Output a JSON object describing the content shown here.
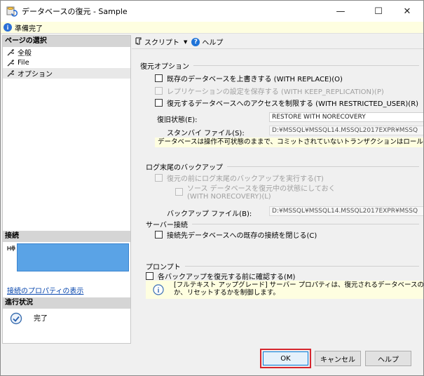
{
  "window": {
    "title": "データベースの復元 - Sample",
    "minimize_glyph": "—",
    "maximize_glyph": "☐",
    "close_glyph": "✕"
  },
  "status": {
    "text": "準備完了",
    "icon": "info-icon"
  },
  "left": {
    "pages_header": "ページの選択",
    "pages": [
      {
        "label": "全般",
        "icon": "wrench-icon"
      },
      {
        "label": "File",
        "icon": "wrench-icon"
      },
      {
        "label": "オプション",
        "icon": "wrench-icon",
        "selected": true
      }
    ],
    "connection_header": "接続",
    "connection_icon": "server-connection-icon",
    "connection_link": "接続のプロパティの表示",
    "progress_header": "進行状況",
    "progress_text": "完了",
    "progress_icon": "check-circle-icon"
  },
  "toolbar": {
    "script_label": "スクリプト",
    "script_icon": "script-icon",
    "help_label": "ヘルプ",
    "help_icon": "help-icon"
  },
  "restore_options": {
    "title": "復元オプション",
    "overwrite": {
      "label": "既存のデータベースを上書きする (WITH REPLACE)(O)",
      "checked": false,
      "enabled": true
    },
    "keep_replication": {
      "label": "レプリケーションの設定を保存する (WITH KEEP_REPLICATION)(P)",
      "checked": false,
      "enabled": false
    },
    "restricted_user": {
      "label": "復元するデータベースへのアクセスを制限する (WITH RESTRICTED_USER)(R)",
      "checked": false,
      "enabled": true
    },
    "recovery_state_label": "復旧状態(E):",
    "recovery_state_value": "RESTORE WITH NORECOVERY",
    "standby_file_label": "スタンバイ ファイル(S):",
    "standby_file_value": "D:¥MSSQL¥MSSQL14.MSSQL2017EXPR¥MSSQ",
    "recovery_note": "データベースは操作不可状態のままで、コミットされていないトランザクションはロールバックしない。"
  },
  "tail_log": {
    "title": "ログ末尾のバックアップ",
    "take_backup": {
      "label": "復元の前にログ末尾のバックアップを実行する(T)",
      "checked": false,
      "enabled": false
    },
    "leave_restoring_line1": "ソース データベースを復元中の状態にしておく",
    "leave_restoring_line2": "(WITH NORECOVERY)(L)",
    "backup_file_label": "バックアップ ファイル(B):",
    "backup_file_value": "D:¥MSSQL¥MSSQL14.MSSQL2017EXPR¥MSSQ"
  },
  "server_connections": {
    "title": "サーバー接続",
    "close_connections": {
      "label": "接続先データベースへの既存の接続を閉じる(C)",
      "checked": false,
      "enabled": true
    }
  },
  "prompt": {
    "title": "プロンプト",
    "confirm": {
      "label": "各バックアップを復元する前に確認する(M)",
      "checked": false,
      "enabled": true
    },
    "info_line1": "[フルテキスト アップグレード] サーバー プロパティは、復元されるデータベースのフルテキスト",
    "info_line2": "か、リセットするかを制御します。"
  },
  "buttons": {
    "ok": "OK",
    "cancel": "キャンセル",
    "help": "ヘルプ"
  },
  "colors": {
    "highlight_frame": "#d6262e",
    "connection_box": "#5aa3e6",
    "info_blue": "#2a6fd6"
  }
}
